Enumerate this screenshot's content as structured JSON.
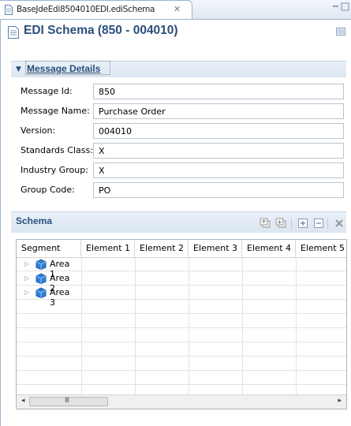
{
  "tab": {
    "title": "BaseJdeEdi8504010EDI.ediSchema",
    "close": "✕"
  },
  "editor": {
    "title": "EDI Schema (850 - 004010)"
  },
  "message_details": {
    "section_label": "Message Details",
    "fields": [
      {
        "label": "Message Id:",
        "value": "850"
      },
      {
        "label": "Message Name:",
        "value": "Purchase Order"
      },
      {
        "label": "Version:",
        "value": "004010"
      },
      {
        "label": "Standards Class:",
        "value": "X"
      },
      {
        "label": "Industry Group:",
        "value": "X"
      },
      {
        "label": "Group Code:",
        "value": "PO"
      }
    ]
  },
  "schema": {
    "section_label": "Schema",
    "toolbar_icons": [
      "move-up-icon",
      "move-down-icon",
      "expand-all-icon",
      "collapse-all-icon",
      "delete-icon"
    ],
    "columns": [
      "Segment",
      "Element 1",
      "Element 2",
      "Element 3",
      "Element 4",
      "Element 5"
    ],
    "rows": [
      {
        "label": "Area 1",
        "icon": "cube-icon"
      },
      {
        "label": "Area 2",
        "icon": "cube-icon"
      },
      {
        "label": "Area 3",
        "icon": "cube-icon"
      }
    ],
    "scroll_left": "◂",
    "scroll_right": "▸",
    "grip": "III"
  },
  "colors": {
    "section_title": "#2b4f7a",
    "section_bg": "#dfe8f3",
    "tab_border": "#9bb3cf"
  }
}
